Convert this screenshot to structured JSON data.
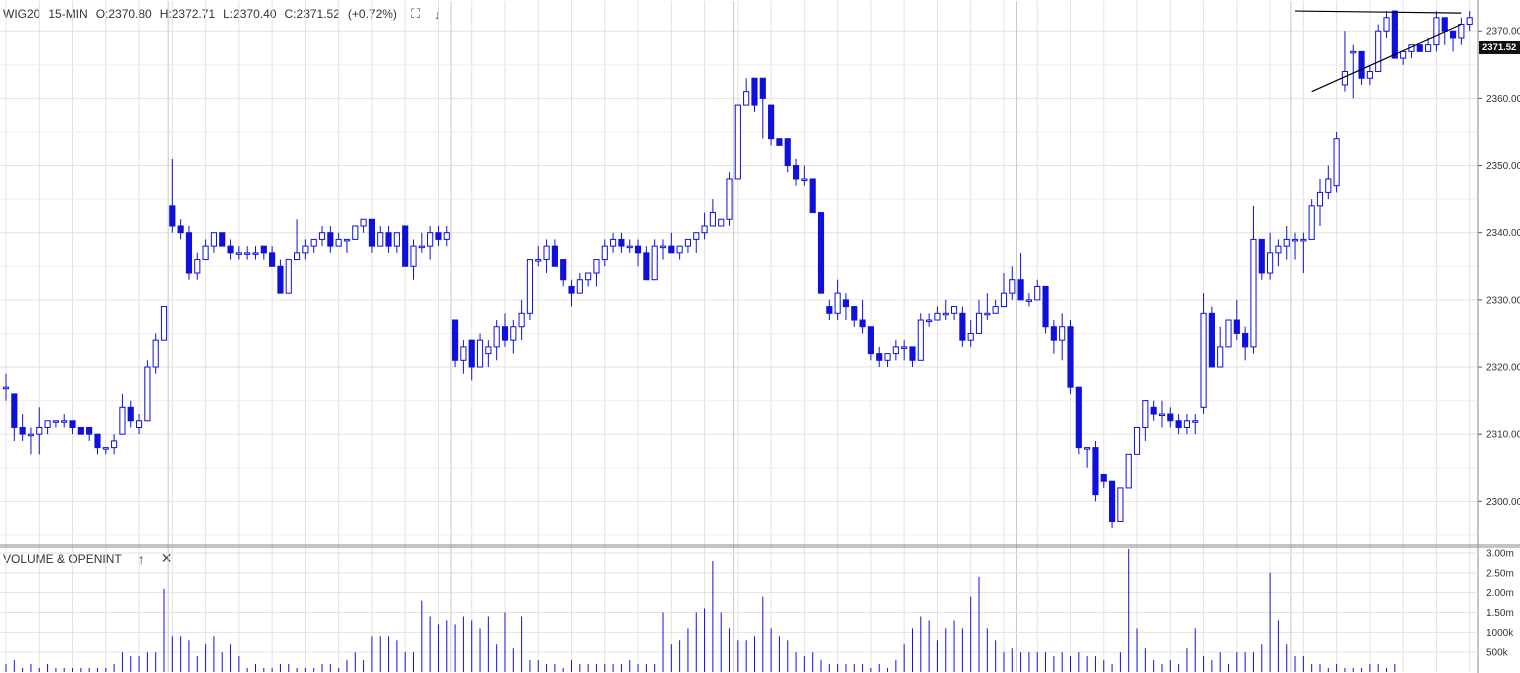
{
  "header": {
    "symbol": "WIG20",
    "interval": "15-MIN",
    "open": "O:2370.80",
    "high": "H:2372.71",
    "low": "L:2370.40",
    "close": "C:2371.52",
    "change": "(+0.72%)",
    "expand_icon": "⛶",
    "download_icon": "↓"
  },
  "volume_panel": {
    "title": "VOLUME & OPENINT",
    "up_icon": "↑",
    "close_icon": "✕"
  },
  "last_price_tag": "2371.52",
  "colors": {
    "down": "#1010dd",
    "up": "#ffffff",
    "wick": "#1010dd",
    "grid": "#e2e2e2",
    "session": "#c8c8c8"
  },
  "chart_data": {
    "type": "candlestick",
    "y_axis": {
      "ticks": [
        "2300.00",
        "2310.00",
        "2320.00",
        "2330.00",
        "2340.00",
        "2350.00",
        "2360.00",
        "2370.00"
      ],
      "range": [
        2293.5,
        2374.5
      ]
    },
    "volume_axis": {
      "ticks": [
        "500k",
        "1000k",
        "1.50m",
        "2.00m",
        "2.50m",
        "3.00m"
      ],
      "range": [
        0,
        3.0
      ]
    },
    "candles": [
      [
        2317,
        2319,
        2315,
        2317
      ],
      [
        2316,
        2316,
        2309,
        2311
      ],
      [
        2311,
        2313,
        2309,
        2310
      ],
      [
        2310,
        2311,
        2307,
        2310
      ],
      [
        2310,
        2314,
        2307,
        2311
      ],
      [
        2311,
        2312,
        2310,
        2312
      ],
      [
        2312,
        2312,
        2311,
        2312
      ],
      [
        2312,
        2313,
        2311,
        2312
      ],
      [
        2312,
        2312,
        2310,
        2311
      ],
      [
        2311,
        2311,
        2310,
        2310
      ],
      [
        2311,
        2311,
        2309,
        2310
      ],
      [
        2310,
        2310,
        2307,
        2308
      ],
      [
        2308,
        2308,
        2307,
        2308
      ],
      [
        2308,
        2310,
        2307,
        2309
      ],
      [
        2310,
        2316,
        2310,
        2314
      ],
      [
        2314,
        2315,
        2311,
        2312
      ],
      [
        2311,
        2313,
        2310,
        2312
      ],
      [
        2312,
        2321,
        2312,
        2320
      ],
      [
        2320,
        2325,
        2319,
        2324
      ],
      [
        2324,
        2329,
        2324,
        2329
      ],
      [
        2344,
        2351,
        2340,
        2341
      ],
      [
        2341,
        2342,
        2339,
        2340
      ],
      [
        2340,
        2341,
        2333,
        2334
      ],
      [
        2334,
        2337,
        2333,
        2336
      ],
      [
        2336,
        2339,
        2336,
        2338
      ],
      [
        2338,
        2340,
        2337,
        2340
      ],
      [
        2340,
        2340,
        2338,
        2338
      ],
      [
        2338,
        2339,
        2336,
        2337
      ],
      [
        2337,
        2338,
        2336,
        2337
      ],
      [
        2337,
        2338,
        2336,
        2337
      ],
      [
        2337,
        2338,
        2336,
        2337
      ],
      [
        2338,
        2338,
        2336,
        2337
      ],
      [
        2337,
        2338,
        2335,
        2335
      ],
      [
        2335,
        2336,
        2331,
        2331
      ],
      [
        2331,
        2336,
        2331,
        2336
      ],
      [
        2336,
        2342,
        2336,
        2337
      ],
      [
        2337,
        2339,
        2336,
        2338
      ],
      [
        2338,
        2339,
        2337,
        2339
      ],
      [
        2339,
        2341,
        2338,
        2340
      ],
      [
        2340,
        2341,
        2337,
        2338
      ],
      [
        2338,
        2340,
        2338,
        2339
      ],
      [
        2339,
        2339,
        2337,
        2339
      ],
      [
        2339,
        2341,
        2339,
        2341
      ],
      [
        2341,
        2342,
        2340,
        2342
      ],
      [
        2342,
        2342,
        2337,
        2338
      ],
      [
        2338,
        2341,
        2338,
        2340
      ],
      [
        2340,
        2341,
        2337,
        2338
      ],
      [
        2338,
        2340,
        2337,
        2340
      ],
      [
        2341,
        2341,
        2335,
        2335
      ],
      [
        2335,
        2339,
        2333,
        2338
      ],
      [
        2338,
        2340,
        2337,
        2338
      ],
      [
        2338,
        2341,
        2336,
        2340
      ],
      [
        2340,
        2341,
        2338,
        2339
      ],
      [
        2339,
        2341,
        2338,
        2340
      ],
      [
        2327,
        2327,
        2320,
        2321
      ],
      [
        2321,
        2324,
        2319,
        2323
      ],
      [
        2324,
        2324,
        2318,
        2320
      ],
      [
        2320,
        2325,
        2320,
        2324
      ],
      [
        2322,
        2324,
        2320,
        2323
      ],
      [
        2323,
        2327,
        2321,
        2326
      ],
      [
        2326,
        2328,
        2323,
        2324
      ],
      [
        2324,
        2327,
        2322,
        2326
      ],
      [
        2326,
        2330,
        2324,
        2328
      ],
      [
        2328,
        2336,
        2327,
        2336
      ],
      [
        2336,
        2338,
        2335,
        2336
      ],
      [
        2336,
        2339,
        2334,
        2338
      ],
      [
        2338,
        2339,
        2335,
        2335
      ],
      [
        2336,
        2336,
        2332,
        2333
      ],
      [
        2332,
        2333,
        2329,
        2331
      ],
      [
        2331,
        2334,
        2331,
        2333
      ],
      [
        2333,
        2334,
        2332,
        2334
      ],
      [
        2334,
        2336,
        2332,
        2336
      ],
      [
        2336,
        2339,
        2335,
        2338
      ],
      [
        2338,
        2340,
        2337,
        2339
      ],
      [
        2339,
        2340,
        2337,
        2338
      ],
      [
        2338,
        2339,
        2337,
        2338
      ],
      [
        2338,
        2339,
        2335,
        2337
      ],
      [
        2337,
        2338,
        2333,
        2333
      ],
      [
        2333,
        2339,
        2333,
        2338
      ],
      [
        2338,
        2339,
        2336,
        2338
      ],
      [
        2338,
        2340,
        2337,
        2337
      ],
      [
        2337,
        2338,
        2336,
        2338
      ],
      [
        2338,
        2339,
        2337,
        2339
      ],
      [
        2339,
        2340,
        2337,
        2340
      ],
      [
        2340,
        2343,
        2339,
        2341
      ],
      [
        2341,
        2345,
        2341,
        2343
      ],
      [
        2341,
        2342,
        2341,
        2342
      ],
      [
        2342,
        2349,
        2341,
        2348
      ],
      [
        2348,
        2359,
        2348,
        2359
      ],
      [
        2359,
        2363,
        2359,
        2361
      ],
      [
        2363,
        2363,
        2358,
        2359
      ],
      [
        2363,
        2363,
        2354,
        2360
      ],
      [
        2359,
        2359,
        2353,
        2354
      ],
      [
        2354,
        2354,
        2353,
        2353
      ],
      [
        2354,
        2354,
        2349,
        2350
      ],
      [
        2350,
        2351,
        2347,
        2348
      ],
      [
        2348,
        2350,
        2347,
        2348
      ],
      [
        2348,
        2348,
        2343,
        2343
      ],
      [
        2343,
        2343,
        2331,
        2331
      ],
      [
        2329,
        2330,
        2327,
        2328
      ],
      [
        2328,
        2333,
        2327,
        2331
      ],
      [
        2330,
        2331,
        2327,
        2329
      ],
      [
        2329,
        2329,
        2326,
        2327
      ],
      [
        2327,
        2330,
        2325,
        2326
      ],
      [
        2326,
        2326,
        2321,
        2322
      ],
      [
        2322,
        2323,
        2320,
        2321
      ],
      [
        2321,
        2322,
        2320,
        2322
      ],
      [
        2322,
        2324,
        2321,
        2323
      ],
      [
        2323,
        2324,
        2321,
        2323
      ],
      [
        2323,
        2323,
        2320,
        2321
      ],
      [
        2321,
        2328,
        2321,
        2327
      ],
      [
        2327,
        2328,
        2326,
        2327
      ],
      [
        2327,
        2329,
        2327,
        2328
      ],
      [
        2328,
        2330,
        2327,
        2328
      ],
      [
        2328,
        2329,
        2327,
        2329
      ],
      [
        2328,
        2329,
        2323,
        2324
      ],
      [
        2324,
        2327,
        2323,
        2325
      ],
      [
        2325,
        2330,
        2325,
        2328
      ],
      [
        2328,
        2331,
        2327,
        2328
      ],
      [
        2328,
        2330,
        2328,
        2329
      ],
      [
        2329,
        2334,
        2329,
        2331
      ],
      [
        2331,
        2335,
        2330,
        2333
      ],
      [
        2333,
        2337,
        2330,
        2330
      ],
      [
        2330,
        2331,
        2329,
        2330
      ],
      [
        2330,
        2333,
        2330,
        2332
      ],
      [
        2332,
        2332,
        2325,
        2326
      ],
      [
        2326,
        2327,
        2322,
        2324
      ],
      [
        2324,
        2328,
        2321,
        2326
      ],
      [
        2326,
        2327,
        2316,
        2317
      ],
      [
        2317,
        2317,
        2307,
        2308
      ],
      [
        2308,
        2308,
        2305,
        2308
      ],
      [
        2308,
        2309,
        2300,
        2301
      ],
      [
        2304,
        2304,
        2302,
        2303
      ],
      [
        2303,
        2303,
        2296,
        2297
      ],
      [
        2297,
        2302,
        2297,
        2302
      ],
      [
        2302,
        2307,
        2302,
        2307
      ],
      [
        2307,
        2311,
        2307,
        2311
      ],
      [
        2311,
        2315,
        2309,
        2315
      ],
      [
        2314,
        2315,
        2312,
        2313
      ],
      [
        2313,
        2315,
        2311,
        2313
      ],
      [
        2313,
        2314,
        2311,
        2312
      ],
      [
        2312,
        2313,
        2310,
        2311
      ],
      [
        2311,
        2313,
        2310,
        2312
      ],
      [
        2312,
        2313,
        2310,
        2312
      ],
      [
        2314,
        2331,
        2313,
        2328
      ],
      [
        2328,
        2329,
        2320,
        2320
      ],
      [
        2320,
        2326,
        2320,
        2323
      ],
      [
        2323,
        2327,
        2323,
        2327
      ],
      [
        2327,
        2330,
        2324,
        2325
      ],
      [
        2325,
        2326,
        2321,
        2323
      ],
      [
        2323,
        2344,
        2322,
        2339
      ],
      [
        2339,
        2339,
        2333,
        2334
      ],
      [
        2334,
        2340,
        2333,
        2337
      ],
      [
        2337,
        2339,
        2335,
        2338
      ],
      [
        2338,
        2341,
        2336,
        2339
      ],
      [
        2339,
        2340,
        2336,
        2339
      ],
      [
        2339,
        2340,
        2334,
        2339
      ],
      [
        2339,
        2345,
        2339,
        2344
      ],
      [
        2344,
        2348,
        2341,
        2346
      ],
      [
        2346,
        2350,
        2345,
        2348
      ],
      [
        2347,
        2355,
        2346,
        2354
      ],
      [
        2362,
        2370,
        2361,
        2364
      ],
      [
        2367,
        2368,
        2360,
        2367
      ],
      [
        2367,
        2367,
        2362,
        2363
      ],
      [
        2363,
        2365,
        2362,
        2364
      ],
      [
        2364,
        2371,
        2364,
        2370
      ],
      [
        2370,
        2373,
        2369,
        2372
      ],
      [
        2373,
        2373,
        2366,
        2366
      ],
      [
        2366,
        2367,
        2365,
        2367
      ],
      [
        2367,
        2368,
        2366,
        2368
      ],
      [
        2368,
        2368,
        2367,
        2367
      ],
      [
        2367,
        2369,
        2367,
        2368
      ],
      [
        2368,
        2373,
        2367,
        2372
      ],
      [
        2372,
        2372,
        2368,
        2370
      ],
      [
        2370,
        2370,
        2367,
        2369
      ],
      [
        2369,
        2372,
        2368,
        2371
      ],
      [
        2371,
        2373,
        2370,
        2372
      ]
    ],
    "volumes": [
      0.2,
      0.3,
      0.1,
      0.2,
      0.1,
      0.2,
      0.1,
      0.1,
      0.1,
      0.1,
      0.1,
      0.1,
      0.1,
      0.2,
      0.5,
      0.4,
      0.4,
      0.5,
      0.5,
      2.1,
      0.9,
      0.9,
      0.8,
      0.4,
      0.7,
      0.9,
      0.5,
      0.7,
      0.4,
      0.1,
      0.2,
      0.1,
      0.1,
      0.2,
      0.2,
      0.1,
      0.1,
      0.1,
      0.2,
      0.2,
      0.1,
      0.3,
      0.5,
      0.3,
      0.9,
      0.9,
      0.9,
      0.8,
      0.5,
      0.5,
      1.8,
      1.4,
      1.2,
      1.3,
      1.2,
      1.4,
      1.3,
      1.1,
      1.4,
      0.7,
      1.5,
      0.6,
      1.4,
      0.3,
      0.3,
      0.2,
      0.2,
      0.1,
      0.3,
      0.2,
      0.2,
      0.2,
      0.2,
      0.2,
      0.2,
      0.3,
      0.2,
      0.2,
      0.2,
      1.5,
      0.7,
      0.8,
      1.1,
      1.5,
      1.6,
      2.8,
      1.5,
      1.1,
      0.8,
      0.8,
      0.9,
      1.9,
      1.1,
      0.9,
      0.8,
      0.5,
      0.4,
      0.5,
      0.3,
      0.2,
      0.2,
      0.2,
      0.2,
      0.2,
      0.1,
      0.2,
      0.1,
      0.3,
      0.7,
      1.1,
      1.4,
      1.3,
      0.8,
      1.1,
      1.3,
      1.1,
      1.9,
      2.4,
      1.1,
      0.8,
      0.5,
      0.6,
      0.5,
      0.5,
      0.5,
      0.5,
      0.4,
      0.5,
      0.4,
      0.5,
      0.4,
      0.4,
      0.3,
      0.2,
      0.5,
      3.1,
      1.1,
      0.6,
      0.3,
      0.2,
      0.3,
      0.2,
      0.6,
      1.1,
      0.4,
      0.3,
      0.5,
      0.2,
      0.5,
      0.5,
      0.5,
      0.7,
      2.5,
      1.3,
      0.7,
      0.4,
      0.4,
      0.2,
      0.2,
      0.1,
      0.2,
      0.1,
      0.1,
      0.1,
      0.2,
      0.2,
      0.1,
      0.2
    ]
  }
}
